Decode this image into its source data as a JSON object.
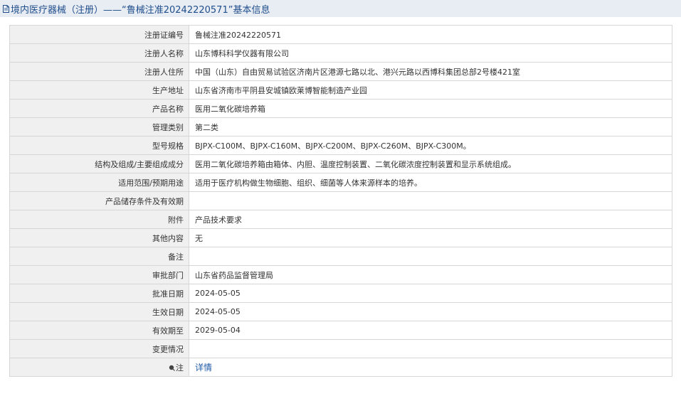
{
  "header": {
    "title": "境内医疗器械（注册）——“鲁械注准20242220571”基本信息",
    "icon": "document-icon"
  },
  "rows": [
    {
      "label": "注册证编号",
      "value": "鲁械注准20242220571"
    },
    {
      "label": "注册人名称",
      "value": "山东博科科学仪器有限公司"
    },
    {
      "label": "注册人住所",
      "value": "中国（山东）自由贸易试验区济南片区港源七路以北、港兴元路以西博科集团总部2号楼421室"
    },
    {
      "label": "生产地址",
      "value": "山东省济南市平阴县安城镇欧莱博智能制造产业园"
    },
    {
      "label": "产品名称",
      "value": "医用二氧化碳培养箱"
    },
    {
      "label": "管理类别",
      "value": "第二类"
    },
    {
      "label": "型号规格",
      "value": "BJPX-C100M、BJPX-C160M、BJPX-C200M、BJPX-C260M、BJPX-C300M。"
    },
    {
      "label": "结构及组成/主要组成成分",
      "value": "医用二氧化碳培养箱由箱体、内胆、温度控制装置、二氧化碳浓度控制装置和显示系统组成。"
    },
    {
      "label": "适用范围/预期用途",
      "value": "适用于医疗机构做生物细胞、组织、细菌等人体来源样本的培养。"
    },
    {
      "label": "产品储存条件及有效期",
      "value": ""
    },
    {
      "label": "附件",
      "value": "产品技术要求"
    },
    {
      "label": "其他内容",
      "value": "无"
    },
    {
      "label": "备注",
      "value": ""
    },
    {
      "label": "审批部门",
      "value": "山东省药品监督管理局"
    },
    {
      "label": "批准日期",
      "value": "2024-05-05"
    },
    {
      "label": "生效日期",
      "value": "2024-05-05"
    },
    {
      "label": "有效期至",
      "value": "2029-05-04"
    },
    {
      "label": "变更情况",
      "value": ""
    }
  ],
  "note": {
    "label": "注",
    "icon": "pin-icon",
    "link": "详情"
  },
  "colors": {
    "header_bg": "#e8ecf3",
    "header_text": "#1f4e8c",
    "label_bg": "#f0f0f0",
    "border": "#d6d6d6",
    "link": "#1f5aa6"
  }
}
